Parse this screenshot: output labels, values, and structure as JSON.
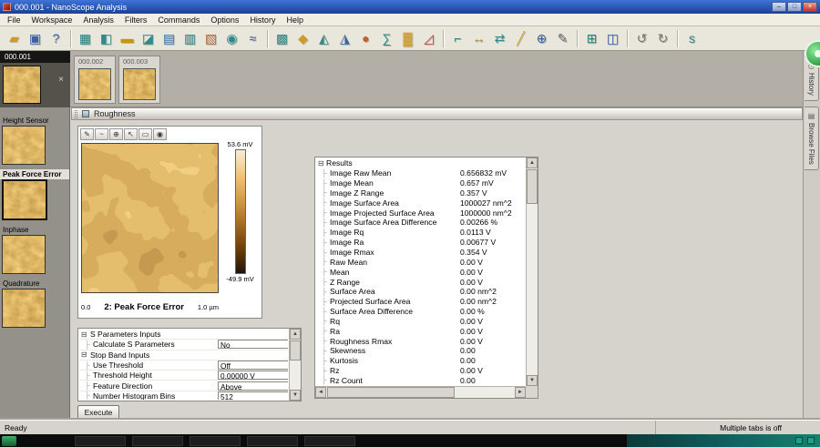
{
  "window": {
    "title": "000.001 - NanoScope Analysis",
    "minimize_glyph": "–",
    "maximize_glyph": "□",
    "close_glyph": "×"
  },
  "glyphs": {
    "expander": "⊟",
    "branch": "├",
    "scroll_up": "▲",
    "scroll_down": "▼",
    "scroll_left": "◄",
    "scroll_right": "►"
  },
  "menu": {
    "items": [
      "File",
      "Workspace",
      "Analysis",
      "Filters",
      "Commands",
      "Options",
      "History",
      "Help"
    ]
  },
  "toolbar": {
    "icons": [
      {
        "name": "open-file-icon",
        "glyph": "▰",
        "color": "#d09a28"
      },
      {
        "name": "save-icon",
        "glyph": "▣",
        "color": "#3a62a8"
      },
      {
        "name": "help-icon",
        "glyph": "?",
        "color": "#2e5fa8"
      },
      {
        "name": "separator"
      },
      {
        "name": "multi-channel-icon",
        "glyph": "▦",
        "color": "#2e8b8b"
      },
      {
        "name": "crop-split-icon",
        "glyph": "◧",
        "color": "#2e8b8b"
      },
      {
        "name": "flatten-icon",
        "glyph": "▬",
        "color": "#c8960c"
      },
      {
        "name": "plane-fit-icon",
        "glyph": "◪",
        "color": "#2e8b8b"
      },
      {
        "name": "lowpass-icon",
        "glyph": "▤",
        "color": "#3a7ab0"
      },
      {
        "name": "median-icon",
        "glyph": "▥",
        "color": "#2e8b8b"
      },
      {
        "name": "erase-icon",
        "glyph": "▧",
        "color": "#b06a3a"
      },
      {
        "name": "gaussian-icon",
        "glyph": "◉",
        "color": "#2e8b8b"
      },
      {
        "name": "spectrum-icon",
        "glyph": "≈",
        "color": "#3a62a8"
      },
      {
        "name": "separator"
      },
      {
        "name": "clean-image-icon",
        "glyph": "▩",
        "color": "#2e8b8b"
      },
      {
        "name": "3d-image-icon",
        "glyph": "◆",
        "color": "#d09a28"
      },
      {
        "name": "bearing-icon",
        "glyph": "◭",
        "color": "#2e8b8b"
      },
      {
        "name": "depth-icon",
        "glyph": "◮",
        "color": "#3a62a8"
      },
      {
        "name": "particle-icon",
        "glyph": "●",
        "color": "#c06030"
      },
      {
        "name": "psd-icon",
        "glyph": "∑",
        "color": "#2e8b8b"
      },
      {
        "name": "roughness-icon",
        "glyph": "▓",
        "color": "#d09a28"
      },
      {
        "name": "section-icon",
        "glyph": "◿",
        "color": "#c0392b"
      },
      {
        "name": "separator"
      },
      {
        "name": "step-icon",
        "glyph": "⌐",
        "color": "#2e8b8b"
      },
      {
        "name": "width-icon",
        "glyph": "↔",
        "color": "#b08020"
      },
      {
        "name": "xy-drift-icon",
        "glyph": "⇄",
        "color": "#2e8b8b"
      },
      {
        "name": "measure-icon",
        "glyph": "╱",
        "color": "#d09a28"
      },
      {
        "name": "zoom-icon",
        "glyph": "⊕",
        "color": "#3a62a8"
      },
      {
        "name": "annotate-icon",
        "glyph": "✎",
        "color": "#666666"
      },
      {
        "name": "separator"
      },
      {
        "name": "grid-icon",
        "glyph": "⊞",
        "color": "#2e8b8b"
      },
      {
        "name": "layout-icon",
        "glyph": "◫",
        "color": "#3a62a8"
      },
      {
        "name": "separator"
      },
      {
        "name": "undo-icon",
        "glyph": "↺",
        "color": "#777777"
      },
      {
        "name": "redo-icon",
        "glyph": "↻",
        "color": "#777777"
      },
      {
        "name": "separator"
      },
      {
        "name": "script-icon",
        "glyph": "s",
        "color": "#2e8b8b"
      }
    ]
  },
  "tabs": {
    "active": {
      "label": "000.001",
      "close": "×"
    },
    "others": [
      {
        "label": "000.002"
      },
      {
        "label": "000.003"
      }
    ]
  },
  "sidebar": {
    "channels": [
      {
        "label": "Height Sensor",
        "selected": false
      },
      {
        "label": "Peak Force Error",
        "selected": true
      },
      {
        "label": "Inphase",
        "selected": false
      },
      {
        "label": "Quadrature",
        "selected": false
      }
    ]
  },
  "panel": {
    "title": "Roughness",
    "viewer": {
      "tools": [
        {
          "name": "draw-tool-icon",
          "glyph": "✎"
        },
        {
          "name": "profile-tool-icon",
          "glyph": "~"
        },
        {
          "name": "zoom-in-tool-icon",
          "glyph": "⊕"
        },
        {
          "name": "select-tool-icon",
          "glyph": "↖"
        },
        {
          "name": "region-tool-icon",
          "glyph": "▭"
        },
        {
          "name": "threshold-tool-icon",
          "glyph": "◉"
        }
      ],
      "scale_top": "53.6 mV",
      "scale_bottom": "-49.9 mV",
      "axis_left": "0.0",
      "axis_right": "1.0 µm",
      "image_label": "2: Peak Force Error"
    },
    "results": {
      "header": "Results",
      "items": [
        {
          "label": "Image Raw Mean",
          "value": "0.656832 mV"
        },
        {
          "label": "Image Mean",
          "value": "0.657 mV"
        },
        {
          "label": "Image Z Range",
          "value": "0.357 V"
        },
        {
          "label": "Image Surface Area",
          "value": "1000027 nm^2"
        },
        {
          "label": "Image Projected Surface Area",
          "value": "1000000 nm^2"
        },
        {
          "label": "Image Surface Area Difference",
          "value": "0.00266 %"
        },
        {
          "label": "Image Rq",
          "value": "0.0113 V"
        },
        {
          "label": "Image Ra",
          "value": "0.00677 V"
        },
        {
          "label": "Image Rmax",
          "value": "0.354 V"
        },
        {
          "label": "Raw Mean",
          "value": "0.00 V"
        },
        {
          "label": "Mean",
          "value": "0.00 V"
        },
        {
          "label": "Z Range",
          "value": "0.00 V"
        },
        {
          "label": "Surface Area",
          "value": "0.00 nm^2"
        },
        {
          "label": "Projected Surface Area",
          "value": "0.00 nm^2"
        },
        {
          "label": "Surface Area Difference",
          "value": "0.00 %"
        },
        {
          "label": "Rq",
          "value": "0.00 V"
        },
        {
          "label": "Ra",
          "value": "0.00 V"
        },
        {
          "label": "Roughness Rmax",
          "value": "0.00 V"
        },
        {
          "label": "Skewness",
          "value": "0.00"
        },
        {
          "label": "Kurtosis",
          "value": "0.00"
        },
        {
          "label": "Rz",
          "value": "0.00 V"
        },
        {
          "label": "Rz Count",
          "value": "0.00"
        }
      ]
    },
    "inputs": {
      "groups": [
        {
          "header": "S Parameters Inputs",
          "rows": [
            {
              "label": "Calculate S Parameters",
              "value": "No"
            }
          ]
        },
        {
          "header": "Stop Band Inputs",
          "rows": [
            {
              "label": "Use Threshold",
              "value": "Off"
            },
            {
              "label": "Threshold Height",
              "value": "0.00000 V"
            },
            {
              "label": "Feature Direction",
              "value": "Above"
            },
            {
              "label": "Number Histogram Bins",
              "value": "512"
            }
          ]
        }
      ]
    },
    "execute_label": "Execute"
  },
  "rail": {
    "tabs": [
      {
        "label": "History",
        "icon_name": "history-clock-icon",
        "icon_glyph": "◷"
      },
      {
        "label": "Browse Files",
        "icon_name": "browse-folder-icon",
        "icon_glyph": "▤"
      }
    ]
  },
  "statusbar": {
    "left": "Ready",
    "right": "Multiple tabs is off"
  }
}
